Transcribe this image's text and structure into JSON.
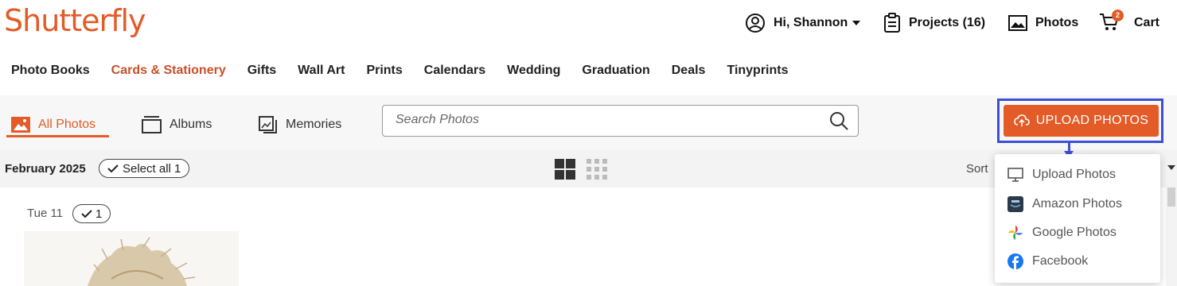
{
  "header": {
    "logo": "Shutterfly",
    "account_label": "Hi, Shannon",
    "projects_label": "Projects (16)",
    "photos_label": "Photos",
    "cart_label": "Cart",
    "cart_count": "2"
  },
  "nav": {
    "items": [
      {
        "label": "Photo Books"
      },
      {
        "label": "Cards & Stationery"
      },
      {
        "label": "Gifts"
      },
      {
        "label": "Wall Art"
      },
      {
        "label": "Prints"
      },
      {
        "label": "Calendars"
      },
      {
        "label": "Wedding"
      },
      {
        "label": "Graduation"
      },
      {
        "label": "Deals"
      },
      {
        "label": "Tinyprints"
      }
    ],
    "active_index": 1
  },
  "toolbar": {
    "tabs": [
      {
        "label": "All Photos"
      },
      {
        "label": "Albums"
      },
      {
        "label": "Memories"
      }
    ],
    "search_placeholder": "Search Photos",
    "upload_button": "UPLOAD PHOTOS"
  },
  "datebar": {
    "month": "February 2025",
    "select_all": "Select all 1",
    "sort_label": "Sort"
  },
  "content": {
    "day": "Tue 11",
    "day_count": "1"
  },
  "upload_menu": {
    "items": [
      {
        "label": "Upload Photos",
        "icon": "monitor-icon"
      },
      {
        "label": "Amazon Photos",
        "icon": "amazon-photos-icon"
      },
      {
        "label": "Google Photos",
        "icon": "google-photos-icon"
      },
      {
        "label": "Facebook",
        "icon": "facebook-icon"
      }
    ]
  },
  "colors": {
    "brand": "#e35b27",
    "highlight": "#3d4ed8",
    "facebook": "#1877f2"
  }
}
